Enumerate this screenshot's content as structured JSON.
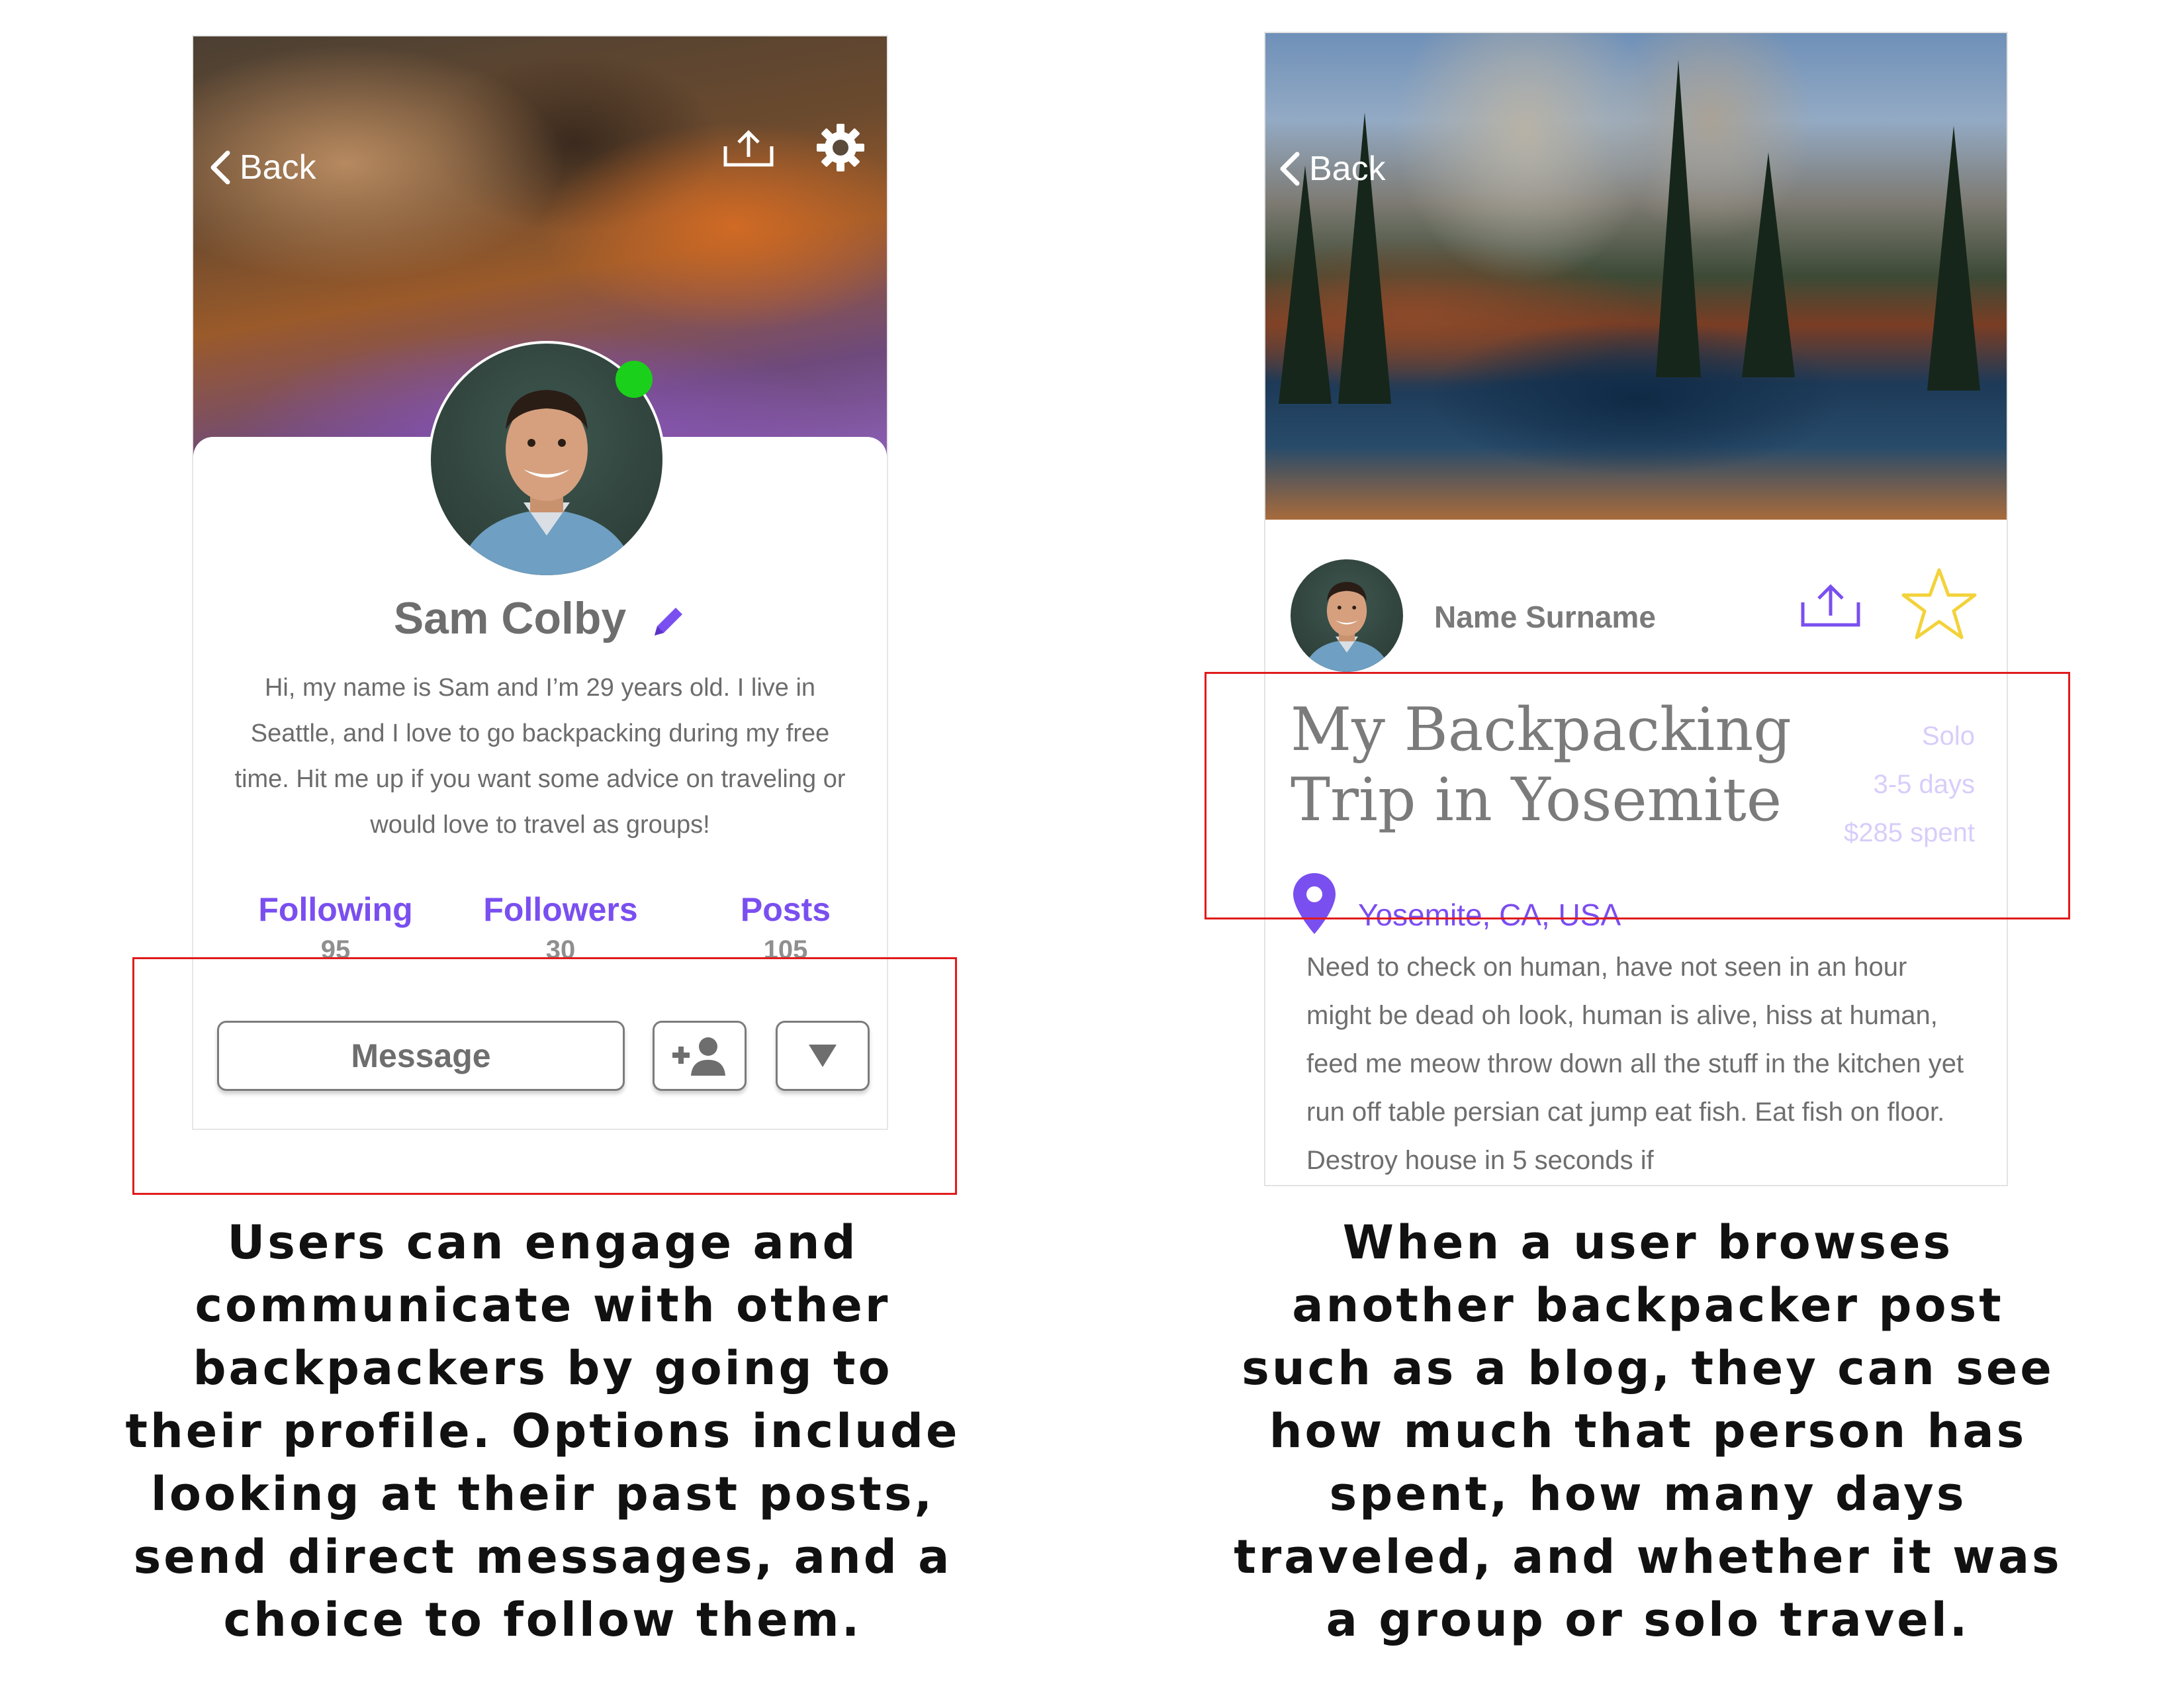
{
  "profile_screen": {
    "back_label": "Back",
    "name": "Sam Colby",
    "bio": "Hi, my name is Sam and I’m 29 years old. I live in Seattle, and I love to go backpacking during my free time. Hit me up if you want some advice on traveling or would love to travel as groups!",
    "stats": [
      {
        "label": "Following",
        "value": "95"
      },
      {
        "label": "Followers",
        "value": "30"
      },
      {
        "label": "Posts",
        "value": "105"
      }
    ],
    "message_label": "Message",
    "online_status_color": "#1ad01a",
    "accent_color": "#7a4ff0",
    "icons": [
      "back-chevron-icon",
      "share-icon",
      "gear-icon",
      "pencil-icon",
      "add-user-icon",
      "dropdown-triangle-icon"
    ]
  },
  "post_screen": {
    "back_label": "Back",
    "author": "Name Surname",
    "title_line1": "My Backpacking",
    "title_line2": "Trip in Yosemite",
    "meta": [
      "Solo",
      "3-5 days",
      "$285 spent"
    ],
    "location": "Yosemite, CA, USA",
    "body": "Need to check on human, have not seen in an hour might be dead oh look, human is alive, hiss at human, feed me meow throw down all the stuff in the kitchen yet run off table persian cat jump eat fish. Eat fish on floor. Destroy house in 5 seconds if",
    "icons": [
      "back-chevron-icon",
      "share-icon",
      "star-outline-icon",
      "location-pin-icon"
    ],
    "star_color": "#f3d23a"
  },
  "captions": {
    "left": "Users can engage and communicate with other backpackers by going to their profile. Options include looking at their past posts, send direct messages, and a choice to follow them.",
    "right": "When a user browses another backpacker post such as a blog, they can see how much that person has spent, how many days traveled, and whether it was a group or solo travel."
  },
  "highlight_color": "#e11b1b"
}
